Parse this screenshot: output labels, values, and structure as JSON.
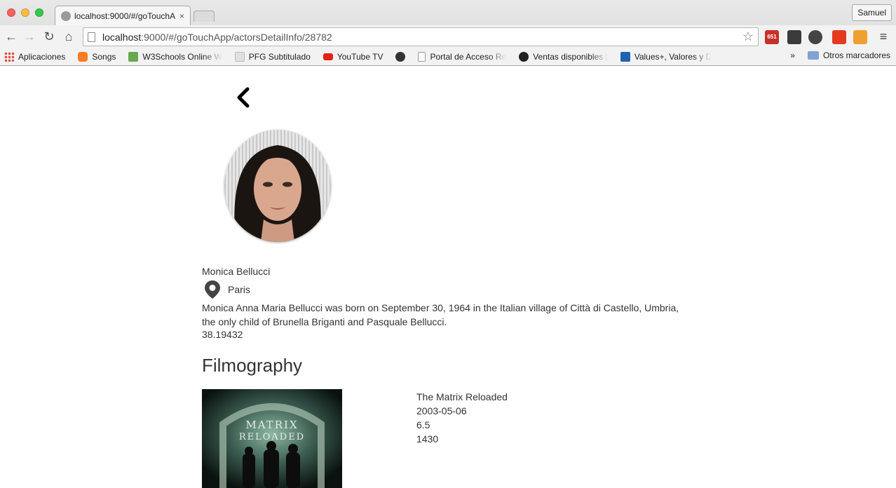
{
  "browser": {
    "tab_title": "localhost:9000/#/goTouchA",
    "tab_close": "×",
    "profile_name": "Samuel",
    "url_host": "localhost",
    "url_path": ":9000/#/goTouchApp/actorsDetailInfo/28782",
    "gmail_badge": "651",
    "bookmarks": [
      {
        "label": "Aplicaciones",
        "icon": "apps-grid-icon",
        "color": "#e04a3c"
      },
      {
        "label": "Songs",
        "icon": "songs-icon",
        "color": "#f57c22"
      },
      {
        "label": "W3Schools Online W",
        "icon": "w3schools-icon",
        "color": "#6aa84f"
      },
      {
        "label": "PFG Subtitulado",
        "icon": "pfg-icon",
        "color": "#d0d0d0"
      },
      {
        "label": "YouTube TV",
        "icon": "youtube-icon",
        "color": "#e62117"
      },
      {
        "label": "",
        "icon": "chrome-app-icon",
        "color": "#333333"
      },
      {
        "label": "Portal de Acceso Re",
        "icon": "page-icon",
        "color": "#ffffff"
      },
      {
        "label": "Ventas disponibles |",
        "icon": "ventas-icon",
        "color": "#222222"
      },
      {
        "label": "Values+, Valores y D",
        "icon": "values-icon",
        "color": "#1e63b0"
      }
    ],
    "more_bookmarks": "»",
    "other_bookmarks": "Otros marcadores"
  },
  "actor": {
    "name": "Monica Bellucci",
    "place_of_birth": "Paris",
    "biography": "Monica Anna Maria Bellucci was born on September 30, 1964 in the Italian village of Città di Castello, Umbria, the only child of Brunella Briganti and Pasquale Bellucci.",
    "popularity": "38.19432"
  },
  "filmography": {
    "heading": "Filmography",
    "movies": [
      {
        "title": "The Matrix Reloaded",
        "release_date": "2003-05-06",
        "vote_average": "6.5",
        "vote_count": "1430",
        "poster_text_line1": "MATRIX",
        "poster_text_line2": "RELOADED"
      }
    ]
  }
}
